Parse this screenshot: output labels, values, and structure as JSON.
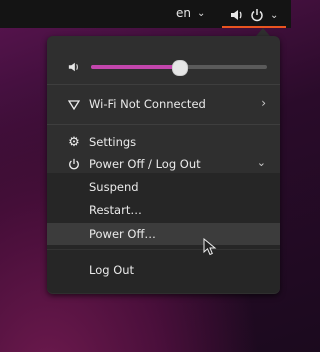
{
  "topbar": {
    "language_label": "en",
    "language_icon": "chevron-down-icon",
    "volume_icon": "speaker-icon",
    "power_icon": "power-icon",
    "system_chevron_icon": "chevron-down-icon",
    "accent_color": "#e95420"
  },
  "menu": {
    "volume": {
      "icon": "speaker-icon",
      "level": 0.5,
      "fill_color": "#c346ad"
    },
    "wifi": {
      "icon": "wifi-icon",
      "label": "Wi-Fi Not Connected"
    },
    "settings": {
      "icon": "gear-icon",
      "label": "Settings"
    },
    "power": {
      "icon": "power-icon",
      "label": "Power Off / Log Out",
      "items": [
        "Suspend",
        "Restart…",
        "Power Off…",
        "Log Out"
      ],
      "hovered_item": "Power Off…"
    }
  }
}
